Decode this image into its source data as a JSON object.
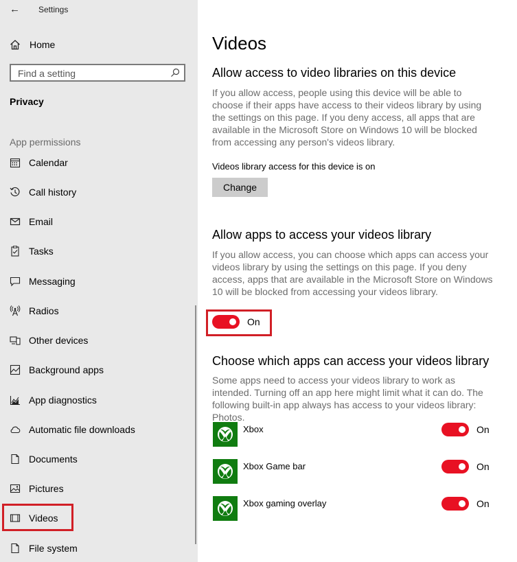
{
  "window": {
    "title": "Settings"
  },
  "sidebar": {
    "home_label": "Home",
    "search_placeholder": "Find a setting",
    "section": "Privacy",
    "group_label": "App permissions",
    "items": [
      {
        "label": "Calendar",
        "icon": "calendar-icon"
      },
      {
        "label": "Call history",
        "icon": "call-history-icon"
      },
      {
        "label": "Email",
        "icon": "email-icon"
      },
      {
        "label": "Tasks",
        "icon": "tasks-icon"
      },
      {
        "label": "Messaging",
        "icon": "messaging-icon"
      },
      {
        "label": "Radios",
        "icon": "radios-icon"
      },
      {
        "label": "Other devices",
        "icon": "other-devices-icon"
      },
      {
        "label": "Background apps",
        "icon": "background-apps-icon"
      },
      {
        "label": "App diagnostics",
        "icon": "app-diagnostics-icon"
      },
      {
        "label": "Automatic file downloads",
        "icon": "cloud-icon"
      },
      {
        "label": "Documents",
        "icon": "document-icon"
      },
      {
        "label": "Pictures",
        "icon": "pictures-icon"
      },
      {
        "label": "Videos",
        "icon": "videos-icon",
        "selected": true
      },
      {
        "label": "File system",
        "icon": "file-system-icon"
      }
    ]
  },
  "main": {
    "title": "Videos",
    "device_access": {
      "heading": "Allow access to video libraries on this device",
      "description": "If you allow access, people using this device will be able to choose if their apps have access to their videos library by using the settings on this page. If you deny access, all apps that are available in the Microsoft Store on Windows 10 will be blocked from accessing any person's videos library.",
      "status": "Videos library access for this device is on",
      "button_label": "Change"
    },
    "apps_access": {
      "heading": "Allow apps to access your videos library",
      "description": "If you allow access, you can choose which apps can access your videos library by using the settings on this page. If you deny access, apps that are available in the Microsoft Store on Windows 10 will be blocked from accessing your videos library.",
      "toggle_label": "On",
      "toggle_on": true
    },
    "choose_apps": {
      "heading": "Choose which apps can access your videos library",
      "description": "Some apps need to access your videos library to work as intended. Turning off an app here might limit what it can do. The following built-in app always has access to your videos library: Photos.",
      "apps": [
        {
          "name": "Xbox",
          "toggle_label": "On",
          "on": true,
          "icon": "xbox-icon"
        },
        {
          "name": "Xbox Game bar",
          "toggle_label": "On",
          "on": true,
          "icon": "xbox-icon"
        },
        {
          "name": "Xbox gaming overlay",
          "toggle_label": "On",
          "on": true,
          "icon": "xbox-icon"
        }
      ]
    }
  },
  "colors": {
    "accent": "#e81123",
    "highlight_box": "#d11f26",
    "sidebar_bg": "#e9e9e9",
    "xbox_green": "#107c10"
  }
}
